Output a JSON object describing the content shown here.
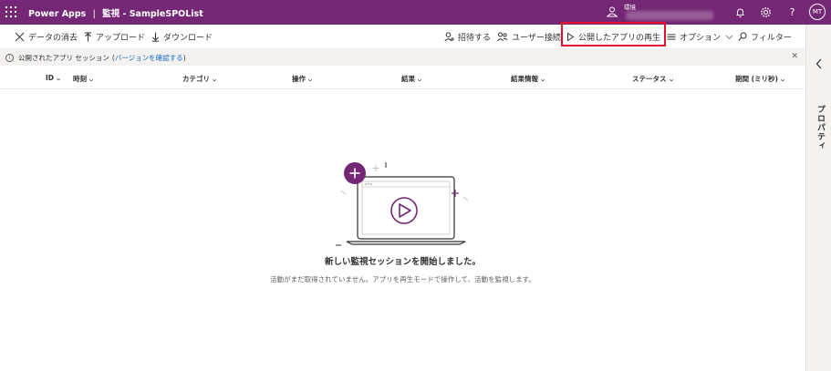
{
  "header": {
    "app_name": "Power Apps",
    "separator": "|",
    "page_title": "監視 - SampleSPOList",
    "environment_label": "環境",
    "help_label": "?",
    "user_initials": "MT"
  },
  "toolbar": {
    "clear_label": "データの消去",
    "upload_label": "アップロード",
    "download_label": "ダウンロード",
    "invite_label": "招待する",
    "connect_user_label": "ユーザー接続",
    "play_published_label": "公開したアプリの再生",
    "options_label": "オプション",
    "filter_label": "フィルター"
  },
  "infobar": {
    "text": "公開されたアプリ セッション",
    "open_paren": "(",
    "link": "バージョンを確認する",
    "close_paren": ")"
  },
  "columns": [
    "ID",
    "時刻",
    "カテゴリ",
    "操作",
    "結果",
    "結果情報",
    "ステータス",
    "期間 (ミリ秒)"
  ],
  "right_panel": {
    "label": "プロパティ"
  },
  "empty_state": {
    "title": "新しい監視セッションを開始しました。",
    "subtitle": "活動がまだ取得されていません。アプリを再生モードで操作して、活動を監視します。"
  },
  "colors": {
    "header_bg": "#742774",
    "highlight": "#e8102e",
    "link": "#0f6cbd"
  }
}
